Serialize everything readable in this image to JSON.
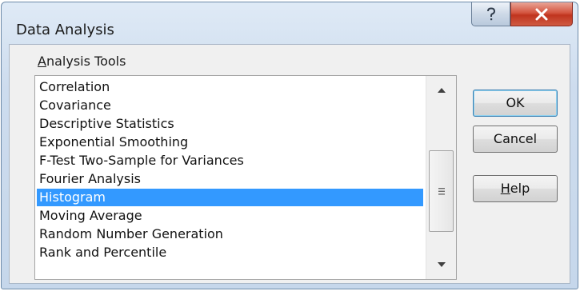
{
  "window": {
    "title": "Data Analysis"
  },
  "titlebar": {
    "help_icon": "question-icon",
    "close_icon": "x-icon",
    "close_color": "#c7402a"
  },
  "analysis_tools": {
    "label_prefix": "A",
    "label_rest": "nalysis Tools",
    "items": [
      "Correlation",
      "Covariance",
      "Descriptive Statistics",
      "Exponential Smoothing",
      "F-Test Two-Sample for Variances",
      "Fourier Analysis",
      "Histogram",
      "Moving Average",
      "Random Number Generation",
      "Rank and Percentile"
    ],
    "selected_index": 6,
    "selection_color": "#3399ff"
  },
  "buttons": {
    "ok": "OK",
    "cancel": "Cancel",
    "help_prefix": "H",
    "help_rest": "elp"
  }
}
